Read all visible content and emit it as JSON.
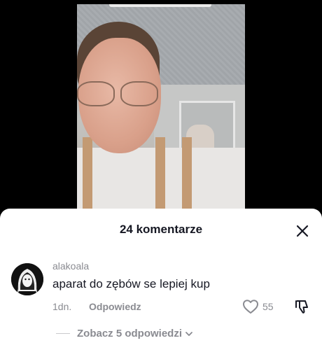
{
  "sheet": {
    "title": "24 komentarze"
  },
  "comment": {
    "username": "alakoala",
    "text": "aparat do zębów se lepiej kup",
    "time": "1dn.",
    "reply_label": "Odpowiedz",
    "likes": "55"
  },
  "replies": {
    "label": "Zobacz 5 odpowiedzi"
  },
  "icons": {
    "close": "close-icon",
    "like": "heart-icon",
    "dislike": "thumbs-down-icon",
    "expand": "chevron-down-icon"
  },
  "colors": {
    "sheet_bg": "#ffffff",
    "text_primary": "#161823",
    "text_secondary": "#8a8b91"
  }
}
